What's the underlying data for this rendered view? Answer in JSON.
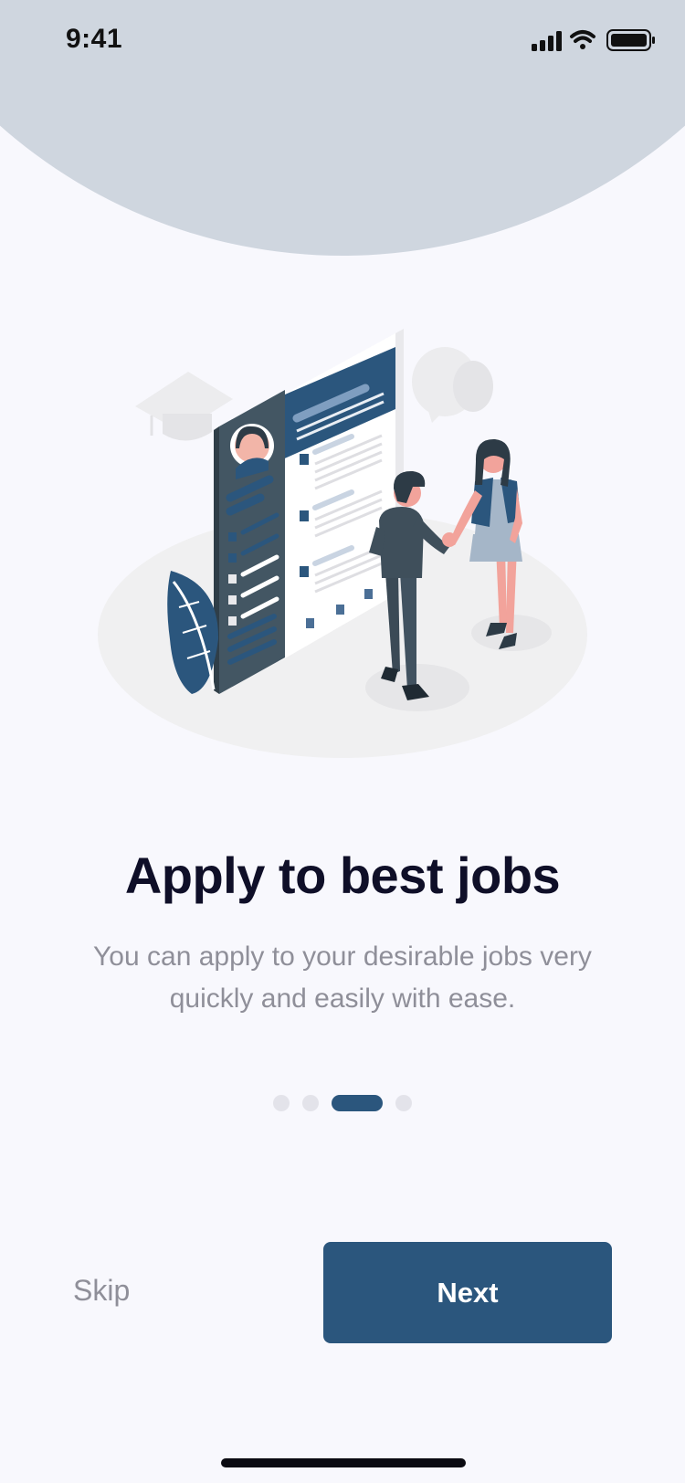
{
  "status_bar": {
    "time": "9:41",
    "signal_icon": "cellular-signal-icon",
    "wifi_icon": "wifi-icon",
    "battery_icon": "battery-icon"
  },
  "onboarding": {
    "illustration": "job-application-illustration",
    "title": "Apply to best jobs",
    "subtitle": "You can apply to your desirable jobs very quickly and easily with ease.",
    "pagination": {
      "total": 4,
      "active_index": 2
    },
    "skip_label": "Skip",
    "next_label": "Next"
  },
  "colors": {
    "background": "#f8f8fd",
    "top_circle": "#cfd6df",
    "primary": "#2b567d",
    "title_text": "#0f0f28",
    "muted_text": "#8f8f99",
    "inactive_dot": "#e3e3ea"
  }
}
